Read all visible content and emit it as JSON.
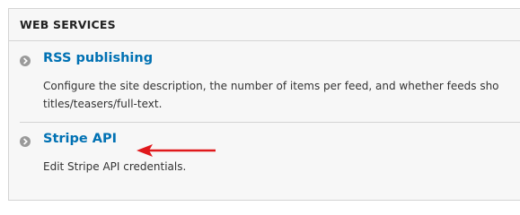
{
  "section": {
    "title": "WEB SERVICES"
  },
  "items": [
    {
      "title": "RSS publishing",
      "description_lines": [
        "Configure the site description, the number of items per feed, and whether feeds sho",
        "titles/teasers/full-text."
      ]
    },
    {
      "title": "Stripe API",
      "description_lines": [
        "Edit Stripe API credentials."
      ]
    }
  ],
  "colors": {
    "link": "#0071b3",
    "annotation_arrow": "#e0191c",
    "bullet": "#9a9a9a"
  },
  "icons": {
    "bullet": "chevron-right-circle-icon",
    "annotation": "arrow-left-icon"
  }
}
